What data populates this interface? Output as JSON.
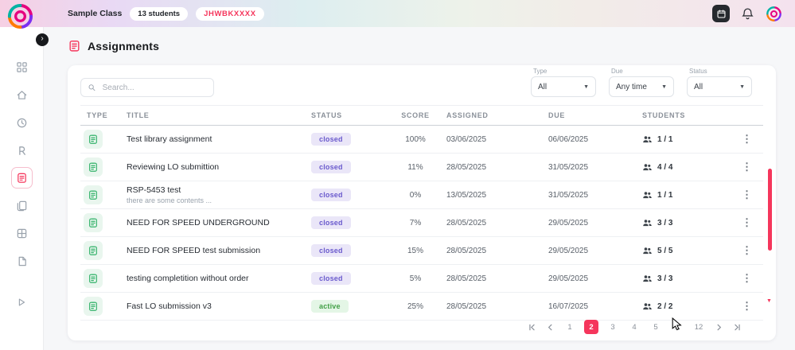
{
  "topbar": {
    "class_name": "Sample Class",
    "students_badge": "13 students",
    "class_code": "JHWBKXXXX"
  },
  "page": {
    "title": "Assignments"
  },
  "filters": {
    "search_placeholder": "Search...",
    "type_label": "Type",
    "type_value": "All",
    "due_label": "Due",
    "due_value": "Any time",
    "status_label": "Status",
    "status_value": "All"
  },
  "table": {
    "headers": {
      "type": "TYPE",
      "title": "TITLE",
      "status": "STATUS",
      "score": "SCORE",
      "assigned": "ASSIGNED",
      "due": "DUE",
      "students": "STUDENTS"
    },
    "rows": [
      {
        "title": "Test library assignment",
        "status": "closed",
        "score": "100%",
        "assigned": "03/06/2025",
        "due": "06/06/2025",
        "students": "1 / 1"
      },
      {
        "title": "Reviewing LO submittion",
        "status": "closed",
        "score": "11%",
        "assigned": "28/05/2025",
        "due": "31/05/2025",
        "students": "4 / 4"
      },
      {
        "title": "RSP-5453 test",
        "subtitle": "there are some contents ...",
        "status": "closed",
        "score": "0%",
        "assigned": "13/05/2025",
        "due": "31/05/2025",
        "students": "1 / 1"
      },
      {
        "title": "NEED FOR SPEED UNDERGROUND",
        "status": "closed",
        "score": "7%",
        "assigned": "28/05/2025",
        "due": "29/05/2025",
        "students": "3 / 3"
      },
      {
        "title": "NEED FOR SPEED test submission",
        "status": "closed",
        "score": "15%",
        "assigned": "28/05/2025",
        "due": "29/05/2025",
        "students": "5 / 5"
      },
      {
        "title": "testing completition without order",
        "status": "closed",
        "score": "5%",
        "assigned": "28/05/2025",
        "due": "29/05/2025",
        "students": "3 / 3"
      },
      {
        "title": "Fast LO submission v3",
        "status": "active",
        "score": "25%",
        "assigned": "28/05/2025",
        "due": "16/07/2025",
        "students": "2 / 2"
      }
    ]
  },
  "pagination": {
    "pages": [
      "1",
      "2",
      "3",
      "4",
      "5",
      "...",
      "12"
    ],
    "active": "2"
  },
  "icons": {
    "topbar": [
      "calendar-icon",
      "bell-icon",
      "avatar-logo"
    ],
    "sidebar": [
      "grid-icon",
      "home-icon",
      "clock-icon",
      "reports-icon",
      "assignments-icon",
      "library-icon",
      "apps-icon",
      "document-icon",
      "play-icon"
    ]
  },
  "colors": {
    "accent": "#f5365c",
    "status_closed_bg": "#eae6f8",
    "status_closed_text": "#6a5acd",
    "status_active_bg": "#e4f6e6",
    "status_active_text": "#43a047",
    "type_icon_green": "#35b36b"
  }
}
